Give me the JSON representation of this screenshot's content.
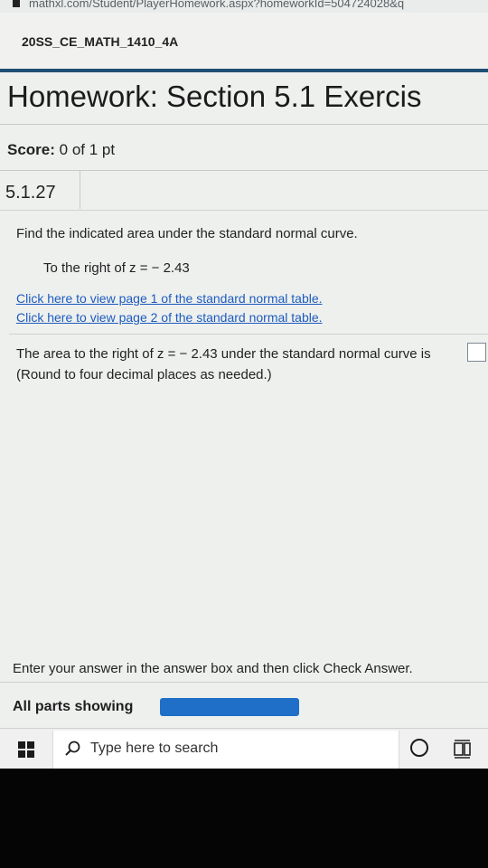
{
  "browser": {
    "url": "mathxl.com/Student/PlayerHomework.aspx?homeworkId=504724028&q"
  },
  "course": {
    "name": "20SS_CE_MATH_1410_4A"
  },
  "homework": {
    "title": "Homework: Section 5.1 Exercis"
  },
  "score": {
    "label": "Score:",
    "value": "0 of 1 pt"
  },
  "question": {
    "number": "5.1.27",
    "prompt": "Find the indicated area under the standard normal curve.",
    "condition": "To the right of z = − 2.43",
    "links": [
      "Click here to view page 1 of the standard normal table.",
      "Click here to view page 2 of the standard normal table."
    ],
    "answer_text": "The area to the right of z = − 2.43 under the standard normal curve is",
    "answer_value": "",
    "round_note": "(Round to four decimal places as needed.)"
  },
  "footer": {
    "instructions": "Enter your answer in the answer box and then click Check Answer.",
    "parts_label": "All parts showing",
    "progress_fraction": 1.0,
    "progress_color": "#1f6fc8"
  },
  "taskbar": {
    "search_placeholder": "Type here to search",
    "icons": [
      "windows-start-icon",
      "search-icon",
      "cortana-icon",
      "task-view-icon"
    ]
  }
}
